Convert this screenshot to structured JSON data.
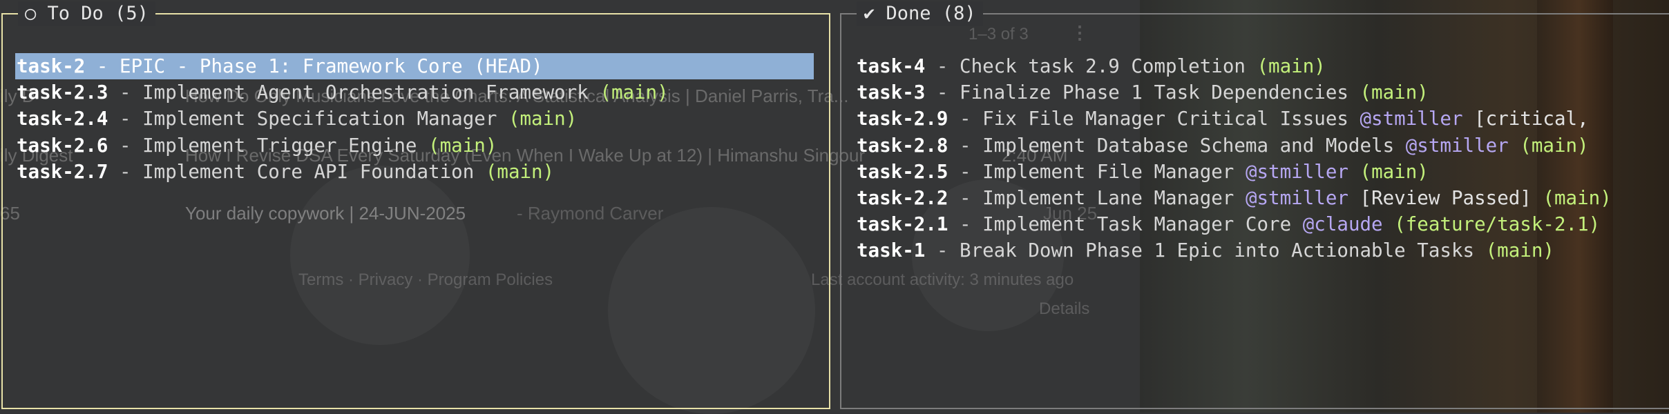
{
  "background": {
    "browser_lines": [
      {
        "prefix": "ily D",
        "text": "How Do Only Musicians Love the Charts: A Statistical Analysis | Daniel Parris, Tra...",
        "time": ""
      },
      {
        "prefix": "ily Digest",
        "text": "How I Revise DSA Every Saturday (Even When I Wake Up at 12) | Himanshu Singour",
        "time": "2:40 AM"
      },
      {
        "prefix": "65",
        "text": "Your daily copywork | 24-JUN-2025",
        "author": "- Raymond Carver",
        "time": "Jun 25"
      }
    ],
    "pagination": "1–3 of 3",
    "footer_links": "Terms · Privacy · Program Policies",
    "last_activity": "Last account activity: 3 minutes ago",
    "details": "Details"
  },
  "todo": {
    "icon": "○",
    "label": "To Do",
    "count": "(5)",
    "tasks": [
      {
        "id": "task-2",
        "sep": " - ",
        "title": "EPIC - Phase 1: Framework Core",
        "assignee": "",
        "labels": "",
        "branch": "(HEAD)",
        "selected": true
      },
      {
        "id": "task-2.3",
        "sep": " - ",
        "title": "Implement Agent Orchestration Framework",
        "assignee": "",
        "labels": "",
        "branch": "(main)",
        "selected": false
      },
      {
        "id": "task-2.4",
        "sep": " - ",
        "title": "Implement Specification Manager",
        "assignee": "",
        "labels": "",
        "branch": "(main)",
        "selected": false
      },
      {
        "id": "task-2.6",
        "sep": " - ",
        "title": "Implement Trigger Engine",
        "assignee": "",
        "labels": "",
        "branch": "(main)",
        "selected": false
      },
      {
        "id": "task-2.7",
        "sep": " - ",
        "title": "Implement Core API Foundation",
        "assignee": "",
        "labels": "",
        "branch": "(main)",
        "selected": false
      }
    ]
  },
  "done": {
    "icon": "✔",
    "label": "Done",
    "count": "(8)",
    "tasks": [
      {
        "id": "task-4",
        "sep": " - ",
        "title": "Check task 2.9 Completion",
        "assignee": "",
        "labels": "",
        "branch": "(main)"
      },
      {
        "id": "task-3",
        "sep": " - ",
        "title": "Finalize Phase 1 Task Dependencies",
        "assignee": "",
        "labels": "",
        "branch": "(main)"
      },
      {
        "id": "task-2.9",
        "sep": " - ",
        "title": "Fix File Manager Critical Issues",
        "assignee": "@stmiller",
        "labels": "[critical,",
        "branch": ""
      },
      {
        "id": "task-2.8",
        "sep": " - ",
        "title": "Implement Database Schema and Models",
        "assignee": "@stmiller",
        "labels": "",
        "branch": "(main)"
      },
      {
        "id": "task-2.5",
        "sep": " - ",
        "title": "Implement File Manager",
        "assignee": "@stmiller",
        "labels": "",
        "branch": "(main)"
      },
      {
        "id": "task-2.2",
        "sep": " - ",
        "title": "Implement Lane Manager",
        "assignee": "@stmiller",
        "labels": "[Review Passed]",
        "branch": "(main)"
      },
      {
        "id": "task-2.1",
        "sep": " - ",
        "title": "Implement Task Manager Core",
        "assignee": "@claude",
        "labels": "",
        "branch": "(feature/task-2.1)"
      },
      {
        "id": "task-1",
        "sep": " - ",
        "title": "Break Down Phase 1 Epic into Actionable Tasks",
        "assignee": "",
        "labels": "",
        "branch": "(main)"
      }
    ]
  },
  "colors": {
    "todo_border": "#e8e2a8",
    "done_border": "#7d7d7d",
    "selection": "#8fb0d6",
    "branch": "#c3f07b",
    "assignee": "#b6a7f2"
  }
}
